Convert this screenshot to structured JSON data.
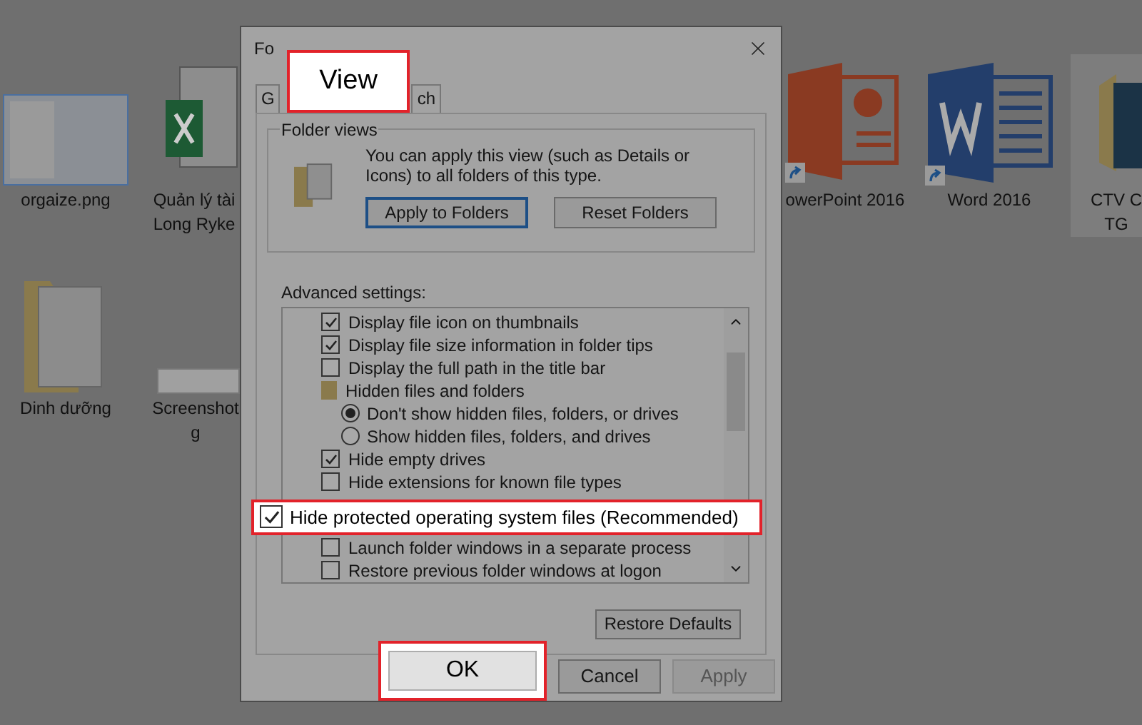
{
  "desktop": {
    "icons": [
      {
        "label": "orgaize.png",
        "kind": "screenshot",
        "shortcut": false,
        "selected": false
      },
      {
        "label": "Quản lý tài\nLong Ryke",
        "kind": "excel",
        "shortcut": false,
        "selected": false
      },
      {
        "label": "owerPoint 2016",
        "kind": "powerpoint",
        "shortcut": true,
        "selected": false
      },
      {
        "label": "Word 2016",
        "kind": "word",
        "shortcut": true,
        "selected": false
      },
      {
        "label": "CTV C\nTG",
        "kind": "psfolder",
        "shortcut": false,
        "selected": true
      },
      {
        "label": "Dinh dưỡng",
        "kind": "folder",
        "shortcut": false,
        "selected": false
      },
      {
        "label": "Screenshot\ng",
        "kind": "strip",
        "shortcut": false,
        "selected": false
      }
    ]
  },
  "dialog": {
    "title": "Fo",
    "tabs": [
      {
        "label": "G"
      },
      {
        "label": "ch"
      }
    ],
    "view_callout": "View",
    "folder_views": {
      "legend": "Folder views",
      "description": "You can apply this view (such as Details or Icons) to all folders of this type.",
      "buttons": [
        {
          "label": "Apply to Folders",
          "focused": true
        },
        {
          "label": "Reset Folders",
          "focused": false
        }
      ]
    },
    "advanced": {
      "label": "Advanced settings:",
      "items": [
        {
          "kind": "checkbox",
          "label": "Display file icon on thumbnails",
          "checked": true
        },
        {
          "kind": "checkbox",
          "label": "Display file size information in folder tips",
          "checked": true
        },
        {
          "kind": "checkbox",
          "label": "Display the full path in the title bar",
          "checked": false
        },
        {
          "kind": "folder",
          "label": "Hidden files and folders",
          "children": [
            {
              "kind": "radio",
              "label": "Don't show hidden files, folders, or drives",
              "selected": true
            },
            {
              "kind": "radio",
              "label": "Show hidden files, folders, and drives",
              "selected": false
            }
          ]
        },
        {
          "kind": "checkbox",
          "label": "Hide empty drives",
          "checked": true
        },
        {
          "kind": "checkbox",
          "label": "Hide extensions for known file types",
          "checked": false
        },
        {
          "kind": "highlighted",
          "label": "Hide protected operating system files (Recommended)",
          "checked": true
        },
        {
          "kind": "checkbox",
          "label": "Launch folder windows in a separate process",
          "checked": false
        },
        {
          "kind": "checkbox",
          "label": "Restore previous folder windows at logon",
          "checked": false
        }
      ]
    },
    "restore": "Restore Defaults",
    "buttons": [
      {
        "label": "OK",
        "highlighted": true,
        "disabled": false
      },
      {
        "label": "Cancel",
        "highlighted": false,
        "disabled": false
      },
      {
        "label": "Apply",
        "highlighted": false,
        "disabled": true
      }
    ]
  }
}
